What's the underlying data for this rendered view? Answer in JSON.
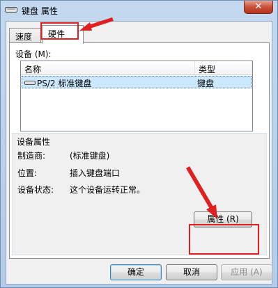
{
  "window": {
    "title": "键盘 属性",
    "close_symbol": "✕",
    "title_icon": "keyboard-icon"
  },
  "tabs": [
    {
      "label": "速度",
      "selected": false
    },
    {
      "label": "硬件",
      "selected": true
    }
  ],
  "devices": {
    "label": "设备 (M):",
    "columns": [
      "名称",
      "类型"
    ],
    "rows": [
      {
        "name": "PS/2 标准键盘",
        "type": "键盘",
        "icon": "keyboard-icon",
        "selected": true
      }
    ]
  },
  "device_properties": {
    "title": "设备属性",
    "items": [
      {
        "label": "制造商:",
        "value": "(标准键盘)"
      },
      {
        "label": "位置:",
        "value": "插入键盘端口"
      },
      {
        "label": "设备状态:",
        "value": "这个设备运转正常。"
      }
    ],
    "properties_button": "属性 (R)"
  },
  "footer": {
    "ok": "确定",
    "cancel": "取消",
    "apply": "应用 (A)"
  },
  "annotations": {
    "color": "#e02020"
  }
}
